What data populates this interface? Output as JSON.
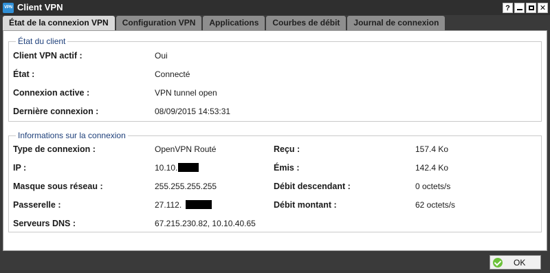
{
  "window": {
    "title": "Client VPN",
    "icon_text": "VPN",
    "buttons": [
      "?",
      "minimize",
      "maximize",
      "close"
    ]
  },
  "tabs": [
    {
      "label": "État de la connexion VPN",
      "active": true
    },
    {
      "label": "Configuration VPN",
      "active": false
    },
    {
      "label": "Applications",
      "active": false
    },
    {
      "label": "Courbes de débit",
      "active": false
    },
    {
      "label": "Journal de connexion",
      "active": false
    }
  ],
  "client_state": {
    "legend": "État du client",
    "rows": [
      {
        "label": "Client VPN actif :",
        "value": "Oui"
      },
      {
        "label": "État :",
        "value": "Connecté"
      },
      {
        "label": "Connexion active :",
        "value": "VPN tunnel open"
      },
      {
        "label": "Dernière connexion :",
        "value": "08/09/2015 14:53:31"
      }
    ]
  },
  "connection_info": {
    "legend": "Informations sur la connexion",
    "left": [
      {
        "label": "Type de connexion :",
        "value": "OpenVPN Routé"
      },
      {
        "label": "IP :",
        "value": "10.10."
      },
      {
        "label": "Masque sous réseau :",
        "value": "255.255.255.255"
      },
      {
        "label": "Passerelle :",
        "value": "27.112."
      },
      {
        "label": "Serveurs DNS :",
        "value": "67.215.230.82, 10.10.40.65"
      }
    ],
    "right": [
      {
        "label": "Reçu :",
        "value": "157.4 Ko"
      },
      {
        "label": "Émis :",
        "value": "142.4 Ko"
      },
      {
        "label": "Débit descendant :",
        "value": "0 octets/s"
      },
      {
        "label": "Débit montant :",
        "value": "62 octets/s"
      }
    ]
  },
  "footer": {
    "ok_label": "OK"
  },
  "colors": {
    "titlebar": "#2f2f2f",
    "tab_inactive": "#8e8e8e",
    "tab_active": "#d9d9d9",
    "legend_text": "#1d3f7a",
    "ok_icon": "#6cc23a"
  }
}
